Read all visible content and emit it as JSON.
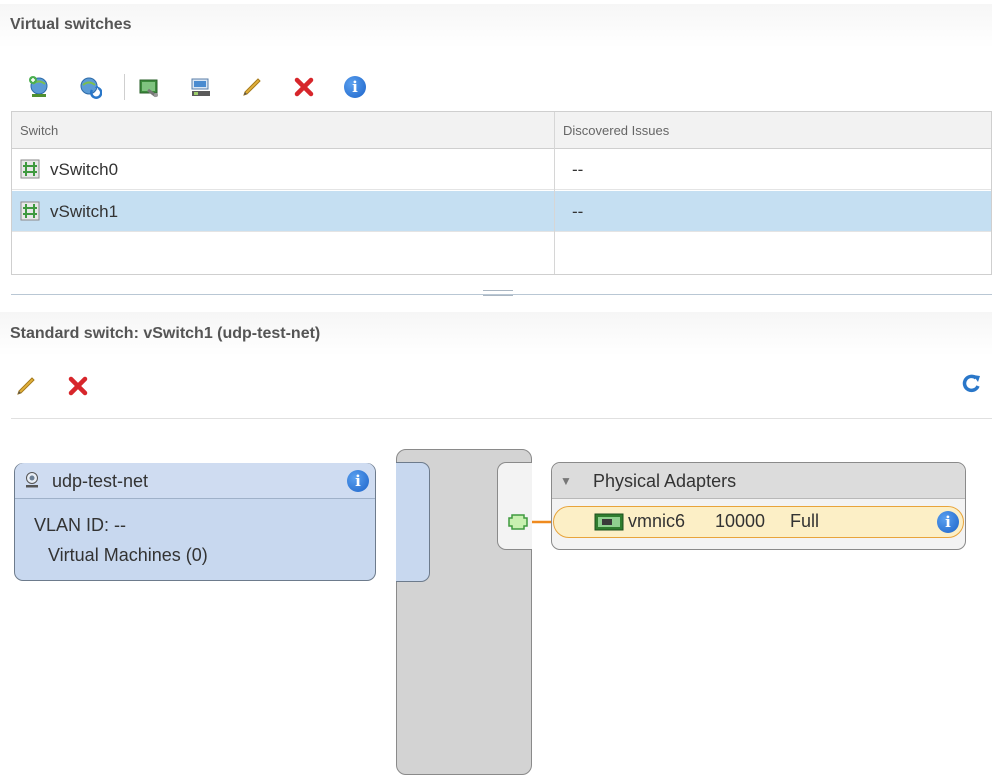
{
  "virtual_switches": {
    "title": "Virtual switches",
    "toolbar": {
      "icons": [
        "add-host-networking-icon",
        "refresh-network-icon",
        "migrate-vmkernel-icon",
        "migrate-vm-icon",
        "edit-icon",
        "remove-icon",
        "info-icon"
      ]
    },
    "table": {
      "columns": [
        "Switch",
        "Discovered Issues"
      ],
      "rows": [
        {
          "switch": "vSwitch0",
          "issues": "--",
          "selected": false
        },
        {
          "switch": "vSwitch1",
          "issues": "--",
          "selected": true
        }
      ]
    }
  },
  "standard_switch": {
    "title": "Standard switch: vSwitch1 (udp-test-net)",
    "toolbar": {
      "icons": [
        "edit-icon",
        "remove-icon",
        "refresh-icon"
      ]
    },
    "portgroup": {
      "name": "udp-test-net",
      "vlan": "VLAN ID: --",
      "vms": "Virtual Machines (0)"
    },
    "physical_adapters": {
      "title": "Physical Adapters",
      "adapters": [
        {
          "name": "vmnic6",
          "speed": "10000",
          "duplex": "Full"
        }
      ]
    },
    "colors": {
      "link": "#ef8a1e",
      "portgroup_bg": "#c8d8ef",
      "selected_row": "#c5dff2",
      "adapter_highlight": "#fcefc6"
    }
  }
}
